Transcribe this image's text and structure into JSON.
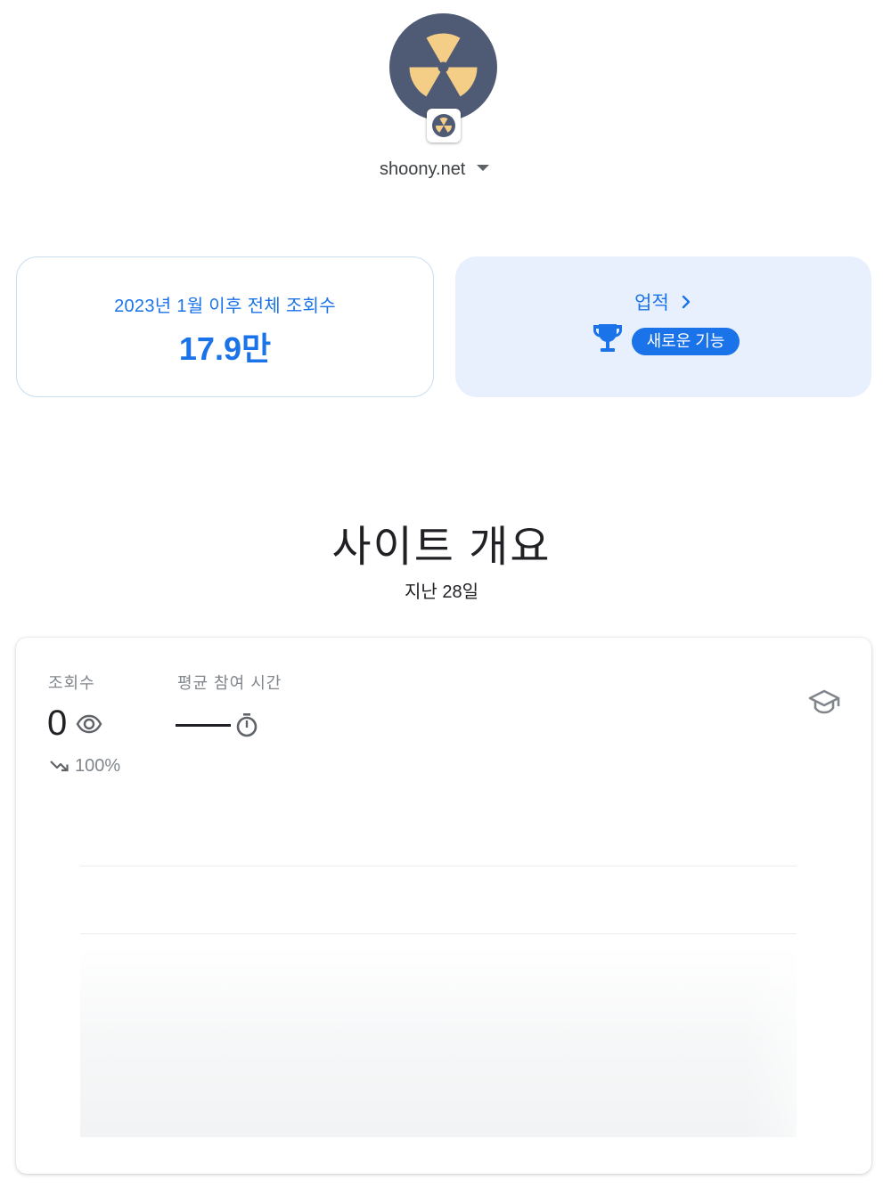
{
  "header": {
    "site_name": "shoony.net",
    "avatar_icon": "radiation-icon",
    "badge_icon": "radiation-icon",
    "colors": {
      "avatar_bg": "#4f5b74",
      "avatar_symbol": "#f4cd86"
    }
  },
  "views_card": {
    "label": "2023년 1월 이후 전체 조회수",
    "value": "17.9만"
  },
  "achievements_card": {
    "label": "업적",
    "badge": "새로운 기능",
    "icon": "trophy-icon"
  },
  "overview": {
    "title": "사이트 개요",
    "period": "지난 28일",
    "metrics": [
      {
        "label": "조회수",
        "value": "0",
        "icon": "eye-icon",
        "trend_icon": "trending-down-icon",
        "change": "100%"
      },
      {
        "label": "평균 참여 시간",
        "value": "—",
        "icon": "timer-icon"
      }
    ],
    "learn_icon": "school-icon",
    "colors": {
      "accent": "#1a73e8",
      "muted": "#80868b"
    }
  }
}
